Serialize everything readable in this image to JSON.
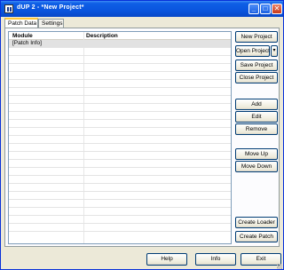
{
  "window": {
    "title": "dUP 2 - *New Project*",
    "minimize_glyph": "_",
    "maximize_glyph": "□",
    "close_glyph": "✕"
  },
  "tabs": [
    {
      "label": "Patch Data",
      "active": true
    },
    {
      "label": "Settings",
      "active": false
    }
  ],
  "grid": {
    "columns": [
      "Module",
      "Description"
    ],
    "rows": [
      {
        "module": "[Patch Info]",
        "description": ""
      }
    ],
    "empty_row_count": 23
  },
  "side_buttons": {
    "new_project": "New Project",
    "open_project": "Open Project",
    "open_dropdown": "▾",
    "save_project": "Save Project",
    "close_project": "Close Project",
    "add": "Add",
    "edit": "Edit",
    "remove": "Remove",
    "move_up": "Move Up",
    "move_down": "Move Down",
    "create_loader": "Create Loader",
    "create_patch": "Create Patch"
  },
  "bottom_buttons": {
    "help": "Help",
    "info": "Info",
    "exit": "Exit"
  },
  "colors": {
    "titlebar": "#0a55de",
    "window_bg": "#ece9d8",
    "selected_row": "#e2e2e2",
    "button_border": "#003c74"
  }
}
